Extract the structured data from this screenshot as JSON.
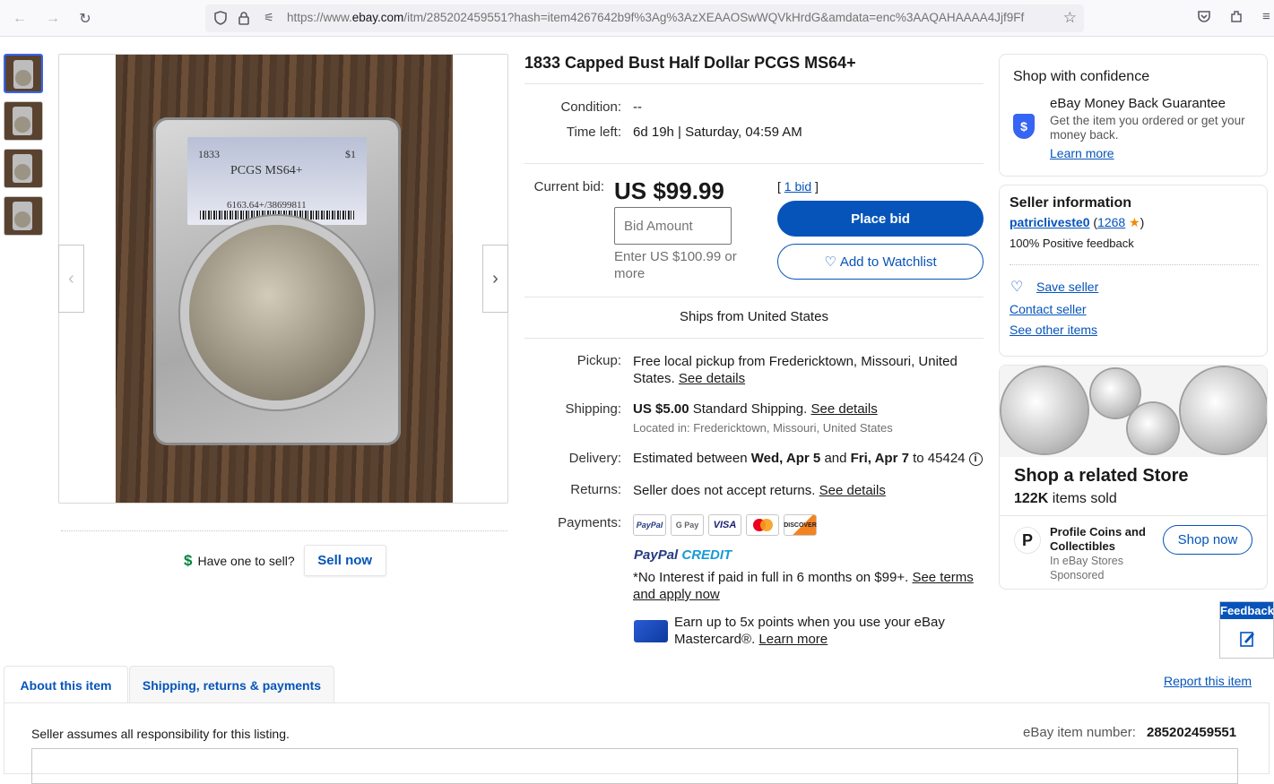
{
  "browser": {
    "url_prefix": "https://www.",
    "url_domain": "ebay.com",
    "url_rest": "/itm/285202459551?hash=item4267642b9f%3Ag%3AzXEAAOSwWQVkHrdG&amdata=enc%3AAQAHAAAA4Jjf9Ff"
  },
  "item": {
    "title": "1833 Capped Bust Half Dollar PCGS MS64+",
    "condition_label": "Condition:",
    "condition_value": "--",
    "time_left_label": "Time left:",
    "time_left_value": "6d 19h | Saturday, 04:59 AM",
    "current_bid_label": "Current bid:",
    "current_bid_value": "US $99.99",
    "bid_count_open": "[ ",
    "bid_count_link": "1 bid",
    "bid_count_close": " ]",
    "bid_placeholder": "Bid Amount",
    "bid_hint": "Enter US $100.99 or more",
    "place_bid": "Place bid",
    "watchlist": "Add to Watchlist",
    "ships_from": "Ships from United States"
  },
  "slab_label": {
    "year": "1833",
    "denomination": "$1",
    "grade": "PCGS MS64+",
    "cert": "6163.64+/38699811"
  },
  "details": {
    "pickup_label": "Pickup:",
    "pickup_text": "Free local pickup from Fredericktown, Missouri, United States.",
    "pickup_link": "See details",
    "shipping_label": "Shipping:",
    "shipping_price": "US $5.00",
    "shipping_text": "Standard Shipping.",
    "shipping_link": "See details",
    "located_in": "Located in: Fredericktown, Missouri, United States",
    "delivery_label": "Delivery:",
    "delivery_prefix": "Estimated between",
    "delivery_date1": "Wed, Apr 5",
    "delivery_and": "and",
    "delivery_date2": "Fri, Apr 7",
    "delivery_to": "to 45424",
    "returns_label": "Returns:",
    "returns_text": "Seller does not accept returns.",
    "returns_link": "See details",
    "payments_label": "Payments:",
    "payment_methods": [
      "PayPal",
      "G Pay",
      "VISA",
      "MC",
      "DISCOVER"
    ],
    "paypal_credit_1": "PayPal",
    "paypal_credit_2": "CREDIT",
    "credit_text": "*No Interest if paid in full in 6 months on $99+.",
    "credit_link": "See terms and apply now",
    "mastercard_text": "Earn up to 5x points when you use your eBay Mastercard®.",
    "mastercard_link": "Learn more"
  },
  "sell": {
    "icon": "$",
    "prompt": "Have one to sell?",
    "button": "Sell now"
  },
  "confidence": {
    "title": "Shop with confidence",
    "guarantee_title": "eBay Money Back Guarantee",
    "guarantee_text": "Get the item you ordered or get your money back.",
    "learn_more": "Learn more"
  },
  "seller": {
    "title": "Seller information",
    "name": "patricliveste0",
    "feedback_count": "1268",
    "positive": "100% Positive feedback",
    "save": "Save seller",
    "contact": "Contact seller",
    "other_items": "See other items"
  },
  "store": {
    "title": "Shop a related Store",
    "sold_count": "122K",
    "sold_suffix": "items sold",
    "store_name": "Profile Coins and Collectibles",
    "store_sub": "In eBay Stores",
    "sponsored": "Sponsored",
    "shop_now": "Shop now"
  },
  "feedback_tab": "Feedback",
  "tabs": {
    "about": "About this item",
    "shipping": "Shipping, returns & payments",
    "report": "Report this item",
    "responsibility": "Seller assumes all responsibility for this listing.",
    "item_number_label": "eBay item number:",
    "item_number": "285202459551"
  },
  "colors": {
    "ebay_blue": "#0654ba",
    "accent_blue": "#3665f3",
    "star_orange": "#f08c00",
    "green": "#05823f"
  }
}
